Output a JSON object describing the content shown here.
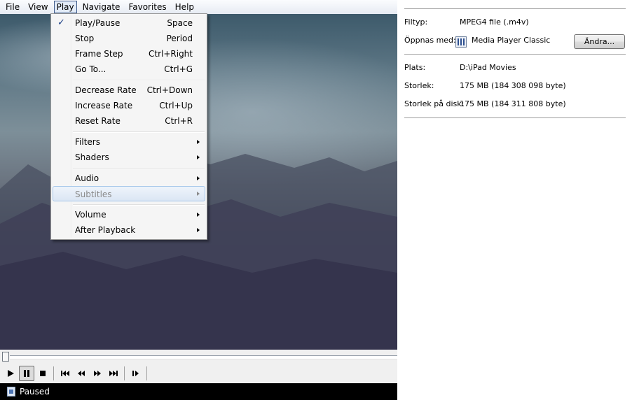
{
  "menubar": {
    "items": [
      "File",
      "View",
      "Play",
      "Navigate",
      "Favorites",
      "Help"
    ],
    "active": "Play"
  },
  "play_menu": {
    "groups": [
      [
        {
          "label": "Play/Pause",
          "shortcut": "Space",
          "checked": true
        },
        {
          "label": "Stop",
          "shortcut": "Period"
        },
        {
          "label": "Frame Step",
          "shortcut": "Ctrl+Right"
        },
        {
          "label": "Go To...",
          "shortcut": "Ctrl+G"
        }
      ],
      [
        {
          "label": "Decrease Rate",
          "shortcut": "Ctrl+Down"
        },
        {
          "label": "Increase Rate",
          "shortcut": "Ctrl+Up"
        },
        {
          "label": "Reset Rate",
          "shortcut": "Ctrl+R"
        }
      ],
      [
        {
          "label": "Filters",
          "submenu": true
        },
        {
          "label": "Shaders",
          "submenu": true
        }
      ],
      [
        {
          "label": "Audio",
          "submenu": true
        },
        {
          "label": "Subtitles",
          "submenu": true,
          "disabled": true,
          "highlighted": true
        }
      ],
      [
        {
          "label": "Volume",
          "submenu": true
        },
        {
          "label": "After Playback",
          "submenu": true
        }
      ]
    ]
  },
  "controls": {
    "buttons": [
      "play-icon",
      "pause-icon",
      "stop-icon",
      "skip-back-icon",
      "rewind-icon",
      "fast-forward-icon",
      "skip-forward-icon",
      "frame-step-icon"
    ],
    "pressed": "pause-icon"
  },
  "status": {
    "text": "Paused"
  },
  "properties": {
    "file_type_label": "Filtyp:",
    "file_type_value": "MPEG4 file (.m4v)",
    "opens_with_label": "Öppnas med:",
    "opens_with_value": "Media Player Classic",
    "change_button": "Ändra...",
    "location_label": "Plats:",
    "location_value": "D:\\iPad Movies",
    "size_label": "Storlek:",
    "size_value": "175 MB (184 308 098 byte)",
    "disk_size_label": "Storlek på disk:",
    "disk_size_value": "175 MB (184 311 808 byte)"
  }
}
